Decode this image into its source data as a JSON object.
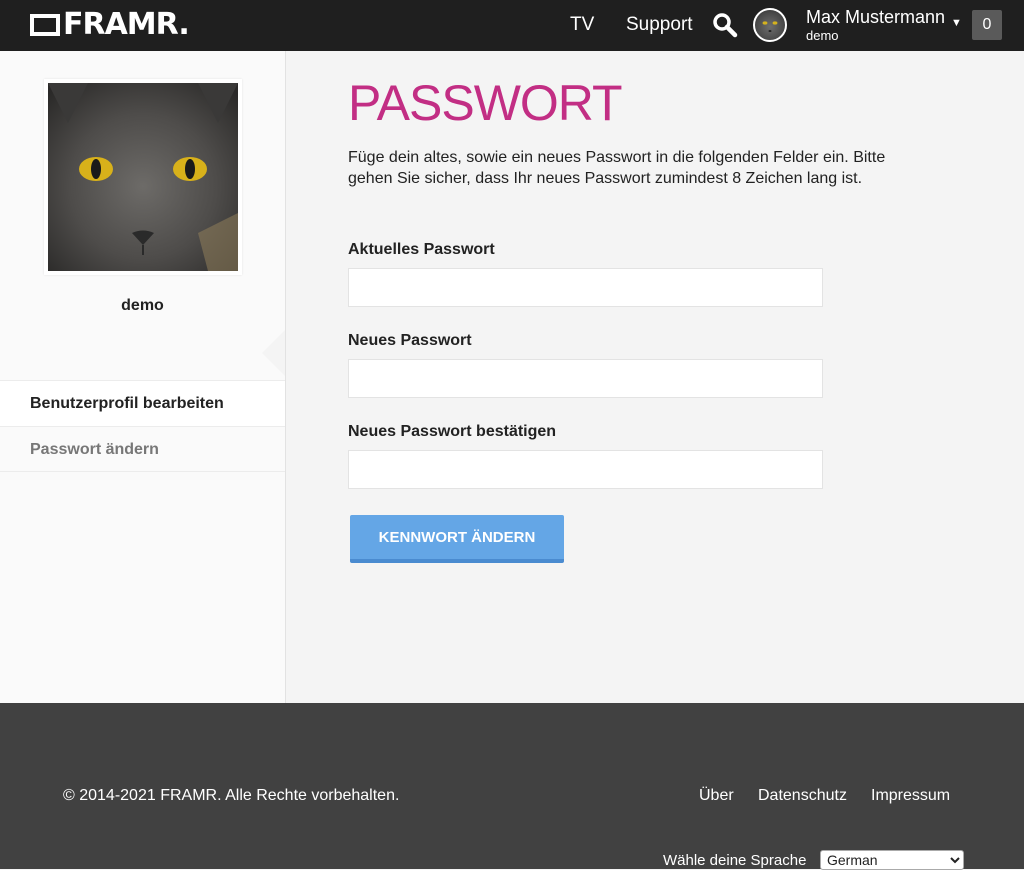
{
  "header": {
    "logo_text": "FRAMR.",
    "nav": {
      "tv": "TV",
      "support": "Support"
    },
    "user": {
      "name": "Max Mustermann",
      "sub": "demo"
    },
    "notifications": "0"
  },
  "sidebar": {
    "profile_name": "demo",
    "menu": {
      "edit_profile": "Benutzerprofil bearbeiten",
      "change_password": "Passwort ändern"
    }
  },
  "main": {
    "title": "PASSWORT",
    "description": "Füge dein altes, sowie ein neues Passwort in die folgenden Felder ein. Bitte gehen Sie sicher, dass Ihr neues Passwort zumindest 8 Zeichen lang ist.",
    "fields": {
      "current": {
        "label": "Aktuelles Passwort",
        "value": ""
      },
      "new": {
        "label": "Neues Passwort",
        "value": ""
      },
      "confirm": {
        "label": "Neues Passwort bestätigen",
        "value": ""
      }
    },
    "submit_label": "KENNWORT ÄNDERN"
  },
  "footer": {
    "copyright": "© 2014-2021 FRAMR. Alle Rechte vorbehalten.",
    "links": {
      "about": "Über",
      "privacy": "Datenschutz",
      "imprint": "Impressum"
    },
    "language_label": "Wähle deine Sprache",
    "language_selected": "German"
  },
  "colors": {
    "title": "#c22e84",
    "button": "#64a6e6",
    "topbar": "#1f1f1f",
    "footer": "#414141"
  }
}
